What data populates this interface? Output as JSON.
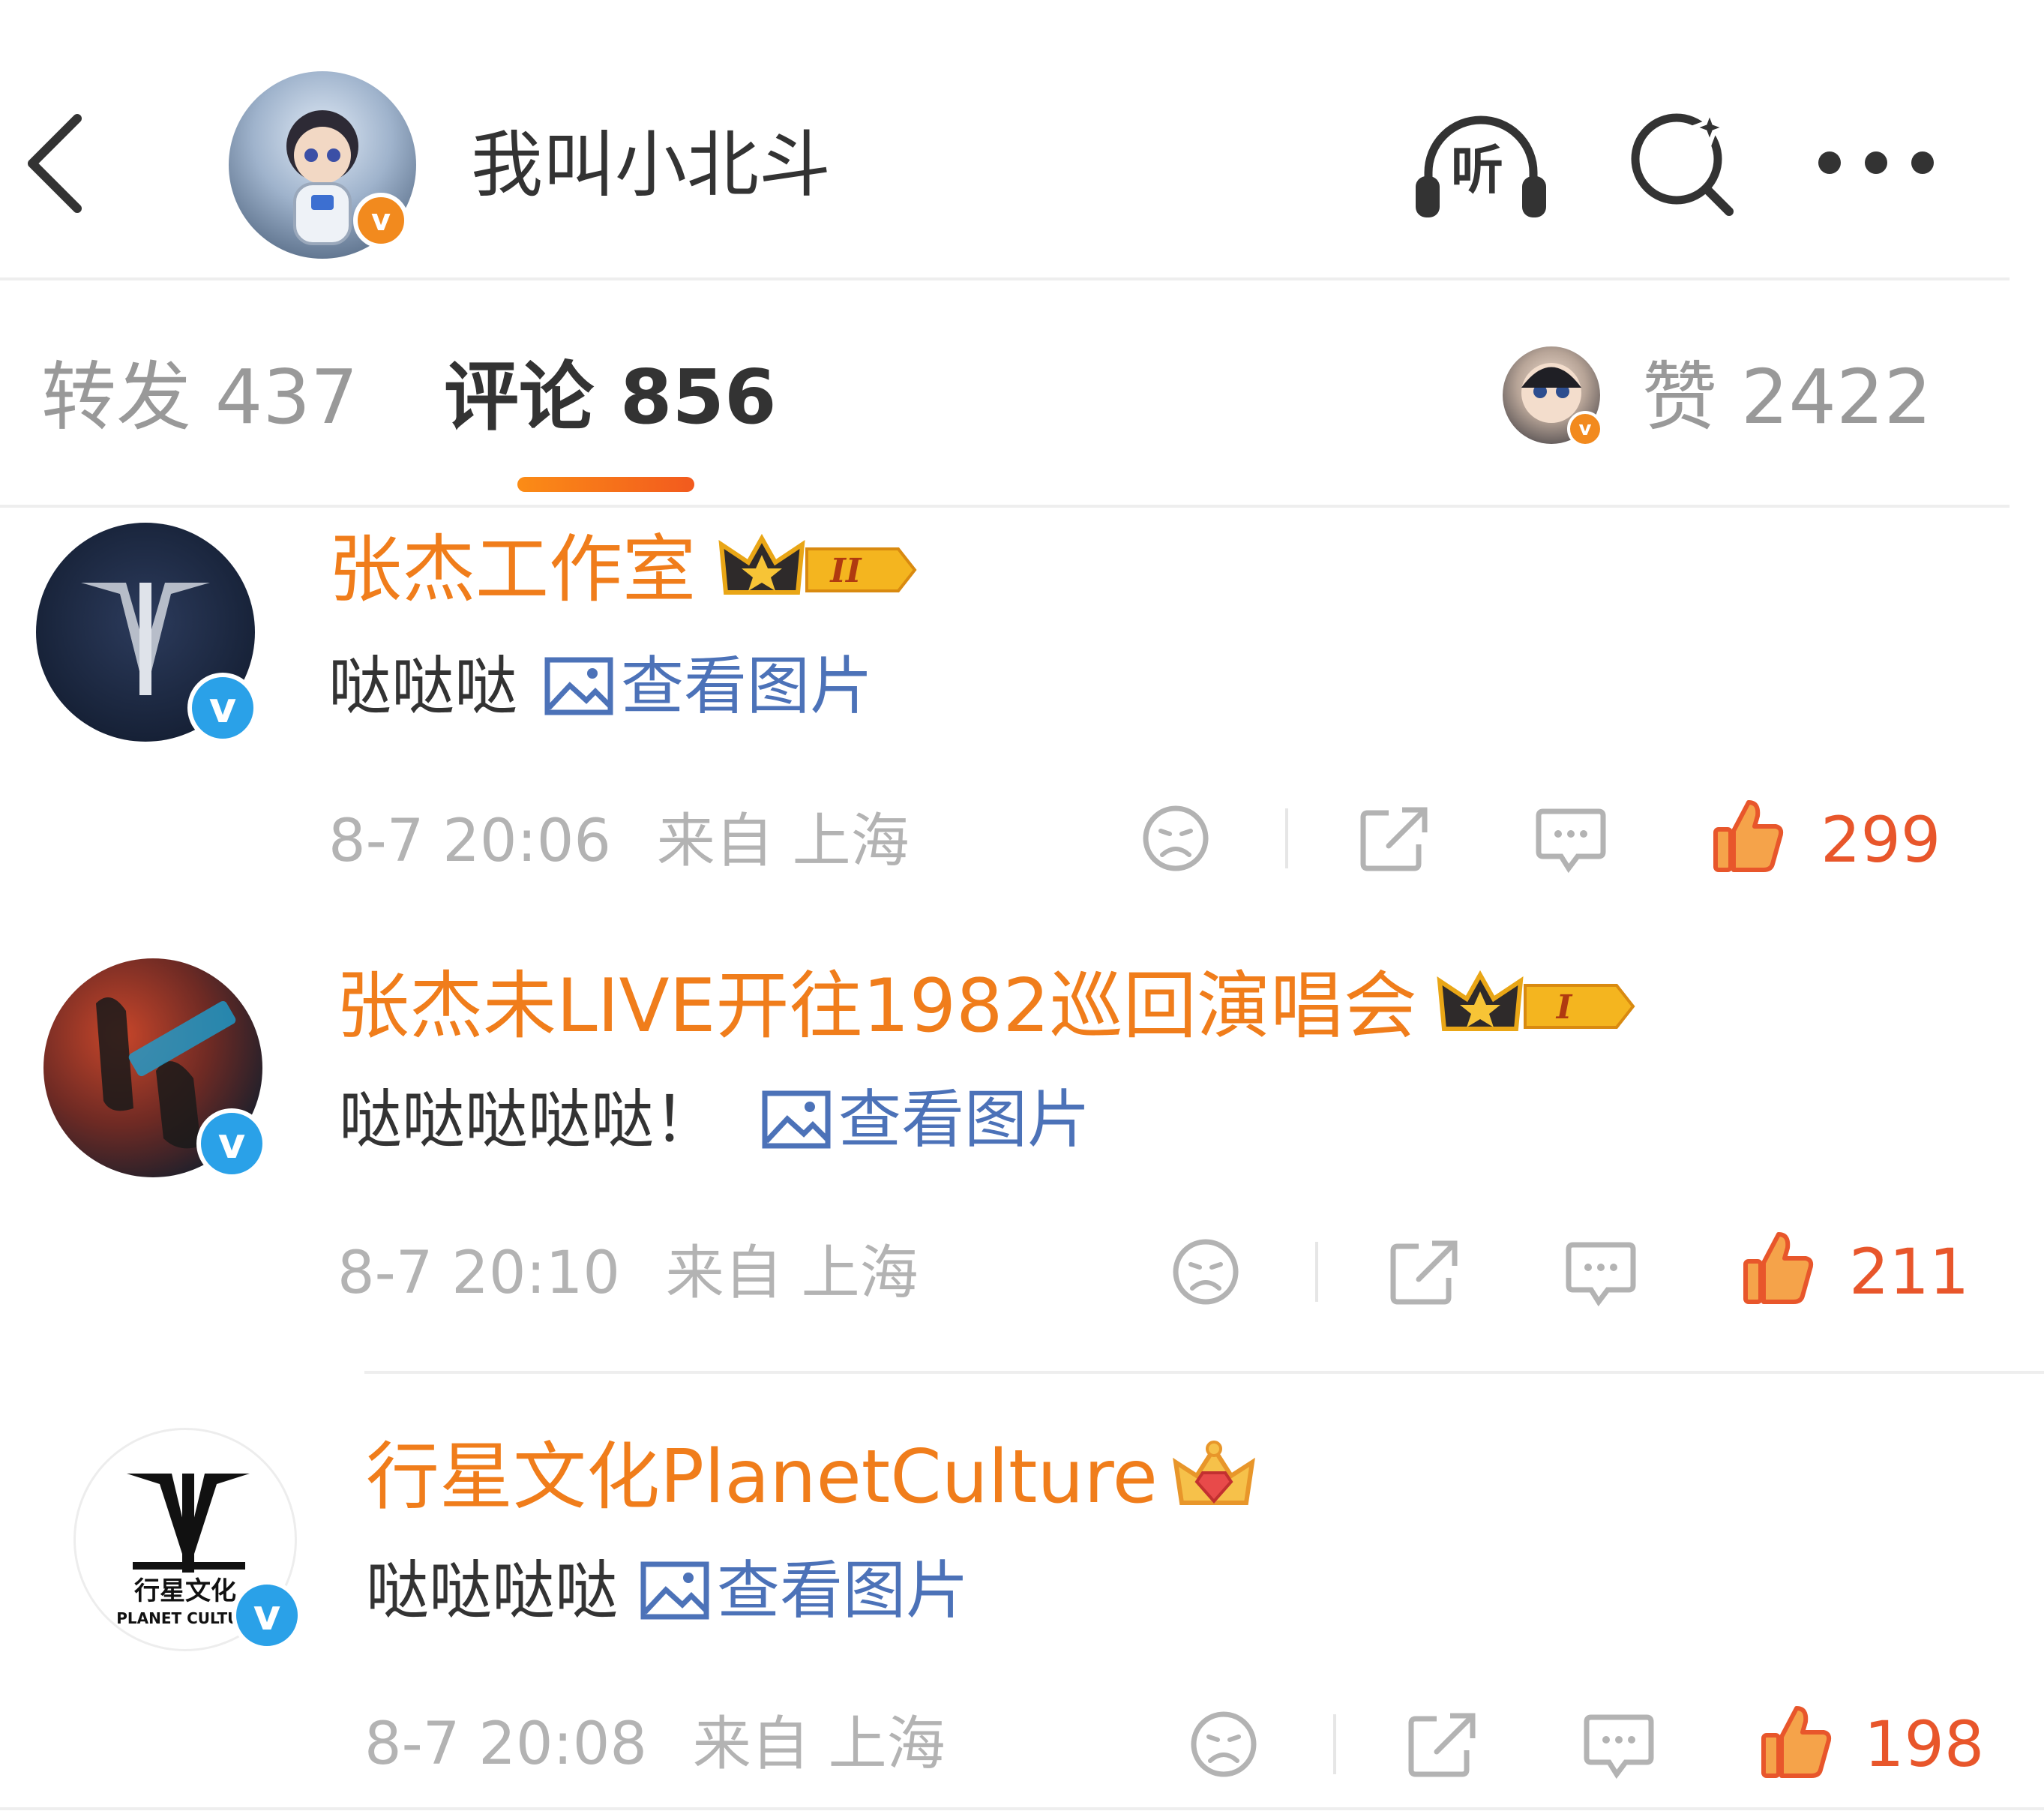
{
  "header": {
    "title": "我叫小北斗",
    "listen_label": "听"
  },
  "tabs": {
    "repost": "转发 437",
    "comment": "评论 856",
    "likes": "赞 2422"
  },
  "colors": {
    "accent_orange": "#f07d1b",
    "link_blue": "#4c72b8",
    "like_red": "#e8562b",
    "muted_gray": "#b3b3b3"
  },
  "comments": [
    {
      "name": "张杰工作室",
      "badge": "II",
      "text": "哒哒哒",
      "view_pic": "查看图片",
      "time": "8-7 20:06",
      "source": "来自 上海",
      "likes": "299"
    },
    {
      "name": "张杰未LIVE开往1982巡回演唱会",
      "badge": "I",
      "text": "哒哒哒哒哒！",
      "view_pic": "查看图片",
      "time": "8-7 20:10",
      "source": "来自 上海",
      "likes": "211"
    },
    {
      "name": "行星文化PlanetCulture",
      "text": "哒哒哒哒",
      "view_pic": "查看图片",
      "time": "8-7 20:08",
      "source": "来自 上海",
      "likes": "198",
      "avatar_text_cn": "行星文化",
      "avatar_text_en": "PLANET CULTUI"
    }
  ]
}
